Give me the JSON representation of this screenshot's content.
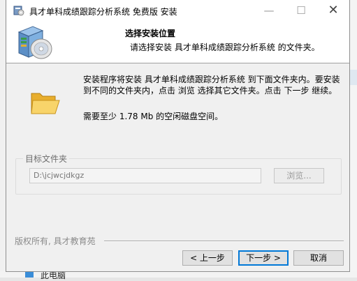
{
  "window": {
    "title": "具才单科成绩跟踪分析系统 免费版 安装",
    "controls": {
      "minimize": "—",
      "maximize": "☐",
      "close": "✕"
    }
  },
  "header": {
    "title": "选择安装位置",
    "subtitle": "请选择安装 具才单科成绩跟踪分析系统 的文件夹。"
  },
  "body": {
    "intro": "安装程序将安装 具才单科成绩跟踪分析系统 到下面文件夹内。要安装到不同的文件夹内，点击 浏览 选择其它文件夹。点击 下一步 继续。",
    "space_required": "需要至少 1.78 Mb 的空闲磁盘空间。"
  },
  "destination": {
    "group_label": "目标文件夹",
    "path_value": "D:\\jcjwcjdkgz",
    "browse_label": "浏览..."
  },
  "footer": {
    "branding": "版权所有, 具才教育苑",
    "back_label": "< 上一步",
    "next_label": "下一步 >",
    "cancel_label": "取消"
  },
  "background": {
    "taskbar_item": "此电脑"
  },
  "icons": {
    "app": "installer-app-icon",
    "header": "installer-box-disc-icon",
    "folder": "folder-open-icon"
  },
  "colors": {
    "accent": "#0078d7",
    "folder": "#f5c242"
  }
}
